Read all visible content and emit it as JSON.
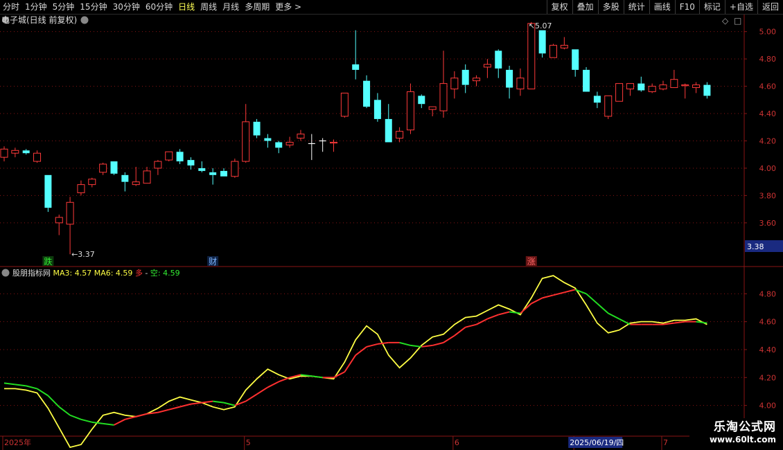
{
  "toolbar": {
    "periods": [
      "分时",
      "1分钟",
      "5分钟",
      "15分钟",
      "30分钟",
      "60分钟",
      "日线",
      "周线",
      "月线",
      "多周期",
      "更多 >"
    ],
    "active": "日线",
    "actions": [
      "复权",
      "叠加",
      "多股",
      "统计",
      "画线",
      "F10",
      "标记",
      "+自选",
      "返回"
    ]
  },
  "main_title": "电子城(日线 前复权)",
  "ind_title": "股朋指标网",
  "ind_legend": {
    "ma3": "MA3: 4.57",
    "ma6": "MA6: 4.59",
    "duo": "多",
    "sep": " - ",
    "kong": "空: 4.59"
  },
  "markers": {
    "die": "跌",
    "cai": "财",
    "zhang": "涨"
  },
  "annotations": {
    "low": "3.37",
    "high": "5.07"
  },
  "price_box": "3.38",
  "colors": {
    "up": "#ff3a3a",
    "down": "#54ffff",
    "ma3": "#ffff44",
    "ma6_up": "#ff3030",
    "ma6_down": "#22dd22",
    "grid": "#8a1515"
  },
  "watermark": {
    "line1": "乐淘公式网",
    "line2": "www.60lt.com"
  },
  "chart_data": [
    {
      "type": "candlestick",
      "title": "电子城(日线 前复权)",
      "y_ticks": [
        3.6,
        3.8,
        4.0,
        4.2,
        4.4,
        4.6,
        4.8,
        5.0
      ],
      "ylim": [
        3.28,
        5.13
      ],
      "x_labels": [
        {
          "i": 0,
          "text": "2025年"
        },
        {
          "i": 22,
          "text": "5"
        },
        {
          "i": 41,
          "text": "6"
        },
        {
          "i": 52,
          "text": "2025/06/19/四"
        },
        {
          "i": 60,
          "text": "7"
        }
      ],
      "ohlc": [
        [
          4.08,
          4.16,
          4.05,
          4.14
        ],
        [
          4.11,
          4.15,
          4.08,
          4.13
        ],
        [
          4.13,
          4.14,
          4.1,
          4.11
        ],
        [
          4.05,
          4.13,
          4.04,
          4.11
        ],
        [
          3.95,
          3.95,
          3.68,
          3.71
        ],
        [
          3.6,
          3.66,
          3.51,
          3.64
        ],
        [
          3.59,
          3.79,
          3.37,
          3.75
        ],
        [
          3.82,
          3.91,
          3.8,
          3.88
        ],
        [
          3.88,
          3.93,
          3.86,
          3.92
        ],
        [
          3.97,
          4.04,
          3.95,
          4.03
        ],
        [
          4.05,
          4.05,
          3.95,
          3.96
        ],
        [
          3.95,
          3.97,
          3.83,
          3.9
        ],
        [
          3.88,
          4.01,
          3.87,
          3.9
        ],
        [
          3.89,
          4.01,
          3.89,
          3.98
        ],
        [
          4.0,
          4.06,
          3.95,
          4.05
        ],
        [
          4.06,
          4.12,
          4.05,
          4.12
        ],
        [
          4.12,
          4.14,
          4.03,
          4.05
        ],
        [
          4.06,
          4.08,
          3.99,
          4.02
        ],
        [
          4.0,
          4.05,
          3.97,
          3.98
        ],
        [
          3.97,
          4.0,
          3.88,
          3.95
        ],
        [
          3.98,
          4.0,
          3.94,
          3.94
        ],
        [
          3.94,
          4.07,
          3.93,
          4.05
        ],
        [
          4.05,
          4.47,
          4.04,
          4.34
        ],
        [
          4.34,
          4.36,
          4.22,
          4.24
        ],
        [
          4.22,
          4.25,
          4.15,
          4.2
        ],
        [
          4.19,
          4.2,
          4.11,
          4.15
        ],
        [
          4.17,
          4.23,
          4.15,
          4.19
        ],
        [
          4.22,
          4.28,
          4.2,
          4.25
        ],
        [
          4.24,
          4.25,
          4.06,
          4.18
        ],
        [
          4.2,
          4.22,
          4.12,
          4.2
        ],
        [
          4.19,
          4.21,
          4.12,
          4.19
        ],
        [
          4.38,
          4.55,
          4.37,
          4.55
        ],
        [
          4.76,
          5.01,
          4.65,
          4.72
        ],
        [
          4.64,
          4.68,
          4.44,
          4.45
        ],
        [
          4.5,
          4.55,
          4.34,
          4.36
        ],
        [
          4.36,
          4.47,
          4.19,
          4.19
        ],
        [
          4.22,
          4.3,
          4.19,
          4.27
        ],
        [
          4.28,
          4.62,
          4.25,
          4.56
        ],
        [
          4.53,
          4.54,
          4.44,
          4.47
        ],
        [
          4.43,
          4.45,
          4.38,
          4.45
        ],
        [
          4.42,
          4.86,
          4.37,
          4.62
        ],
        [
          4.58,
          4.71,
          4.51,
          4.66
        ],
        [
          4.72,
          4.76,
          4.55,
          4.61
        ],
        [
          4.64,
          4.68,
          4.6,
          4.66
        ],
        [
          4.74,
          4.8,
          4.66,
          4.76
        ],
        [
          4.86,
          4.87,
          4.66,
          4.73
        ],
        [
          4.72,
          4.75,
          4.51,
          4.59
        ],
        [
          4.58,
          4.73,
          4.53,
          4.66
        ],
        [
          4.58,
          5.07,
          4.58,
          5.06
        ],
        [
          5.01,
          5.01,
          4.81,
          4.84
        ],
        [
          4.81,
          4.91,
          4.81,
          4.9
        ],
        [
          4.88,
          4.96,
          4.87,
          4.9
        ],
        [
          4.87,
          4.87,
          4.67,
          4.72
        ],
        [
          4.72,
          4.74,
          4.58,
          4.56
        ],
        [
          4.53,
          4.56,
          4.44,
          4.48
        ],
        [
          4.38,
          4.53,
          4.36,
          4.53
        ],
        [
          4.49,
          4.62,
          4.49,
          4.62
        ],
        [
          4.58,
          4.62,
          4.53,
          4.62
        ],
        [
          4.62,
          4.67,
          4.56,
          4.57
        ],
        [
          4.56,
          4.62,
          4.55,
          4.6
        ],
        [
          4.58,
          4.64,
          4.57,
          4.61
        ],
        [
          4.59,
          4.72,
          4.59,
          4.65
        ],
        [
          4.61,
          4.62,
          4.51,
          4.61
        ],
        [
          4.59,
          4.63,
          4.55,
          4.61
        ],
        [
          4.61,
          4.63,
          4.51,
          4.53
        ]
      ],
      "doji_cross": [
        28,
        29
      ],
      "markers": [
        {
          "i": 4,
          "text": "跌"
        },
        {
          "i": 19,
          "text": "财"
        },
        {
          "i": 48,
          "text": "涨"
        }
      ]
    },
    {
      "type": "line",
      "title": "股朋指标网",
      "y_ticks": [
        4.0,
        4.2,
        4.4,
        4.6,
        4.8
      ],
      "ylim": [
        3.78,
        4.99
      ],
      "series": [
        {
          "name": "MA3",
          "values": [
            4.12,
            4.12,
            4.11,
            4.09,
            3.98,
            3.84,
            3.7,
            3.72,
            3.83,
            3.93,
            3.95,
            3.93,
            3.92,
            3.94,
            3.98,
            4.03,
            4.06,
            4.04,
            4.02,
            3.99,
            3.97,
            3.99,
            4.11,
            4.19,
            4.26,
            4.22,
            4.19,
            4.21,
            4.21,
            4.2,
            4.19,
            4.31,
            4.47,
            4.57,
            4.51,
            4.36,
            4.27,
            4.34,
            4.43,
            4.49,
            4.51,
            4.58,
            4.63,
            4.64,
            4.68,
            4.72,
            4.69,
            4.65,
            4.77,
            4.91,
            4.93,
            4.88,
            4.84,
            4.72,
            4.59,
            4.52,
            4.54,
            4.59,
            4.6,
            4.6,
            4.59,
            4.61,
            4.61,
            4.62,
            4.58
          ]
        },
        {
          "name": "MA6",
          "values": [
            4.16,
            4.15,
            4.14,
            4.12,
            4.07,
            3.99,
            3.93,
            3.9,
            3.88,
            3.87,
            3.86,
            3.9,
            3.92,
            3.94,
            3.95,
            3.97,
            3.99,
            4.01,
            4.02,
            4.03,
            4.02,
            4.0,
            4.03,
            4.08,
            4.13,
            4.17,
            4.2,
            4.22,
            4.21,
            4.2,
            4.2,
            4.24,
            4.36,
            4.42,
            4.44,
            4.45,
            4.45,
            4.43,
            4.42,
            4.43,
            4.45,
            4.5,
            4.56,
            4.58,
            4.62,
            4.65,
            4.67,
            4.66,
            4.73,
            4.77,
            4.79,
            4.81,
            4.83,
            4.8,
            4.73,
            4.66,
            4.62,
            4.58,
            4.58,
            4.58,
            4.58,
            4.59,
            4.6,
            4.6,
            4.59
          ]
        }
      ]
    }
  ]
}
